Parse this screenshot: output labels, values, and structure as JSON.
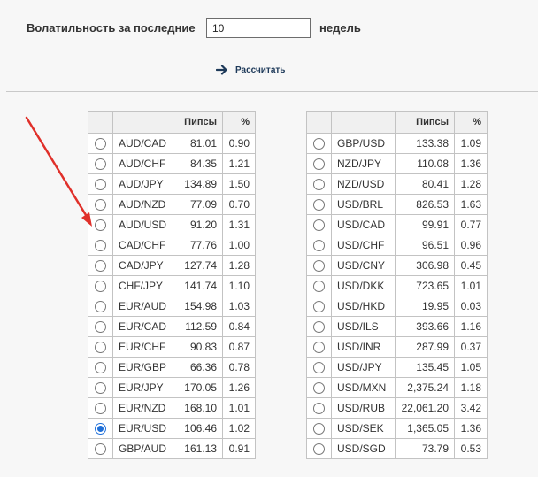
{
  "form": {
    "label": "Волатильность за последние",
    "weeks_value": "10",
    "weeks_unit": "недель",
    "calculate_label": "Рассчитать"
  },
  "table_headers": {
    "pips": "Пипсы",
    "percent": "%"
  },
  "left_rows": [
    {
      "pair": "AUD/CAD",
      "pips": "81.01",
      "pct": "0.90",
      "selected": false
    },
    {
      "pair": "AUD/CHF",
      "pips": "84.35",
      "pct": "1.21",
      "selected": false
    },
    {
      "pair": "AUD/JPY",
      "pips": "134.89",
      "pct": "1.50",
      "selected": false
    },
    {
      "pair": "AUD/NZD",
      "pips": "77.09",
      "pct": "0.70",
      "selected": false
    },
    {
      "pair": "AUD/USD",
      "pips": "91.20",
      "pct": "1.31",
      "selected": false
    },
    {
      "pair": "CAD/CHF",
      "pips": "77.76",
      "pct": "1.00",
      "selected": false
    },
    {
      "pair": "CAD/JPY",
      "pips": "127.74",
      "pct": "1.28",
      "selected": false
    },
    {
      "pair": "CHF/JPY",
      "pips": "141.74",
      "pct": "1.10",
      "selected": false
    },
    {
      "pair": "EUR/AUD",
      "pips": "154.98",
      "pct": "1.03",
      "selected": false
    },
    {
      "pair": "EUR/CAD",
      "pips": "112.59",
      "pct": "0.84",
      "selected": false
    },
    {
      "pair": "EUR/CHF",
      "pips": "90.83",
      "pct": "0.87",
      "selected": false
    },
    {
      "pair": "EUR/GBP",
      "pips": "66.36",
      "pct": "0.78",
      "selected": false
    },
    {
      "pair": "EUR/JPY",
      "pips": "170.05",
      "pct": "1.26",
      "selected": false
    },
    {
      "pair": "EUR/NZD",
      "pips": "168.10",
      "pct": "1.01",
      "selected": false
    },
    {
      "pair": "EUR/USD",
      "pips": "106.46",
      "pct": "1.02",
      "selected": true
    },
    {
      "pair": "GBP/AUD",
      "pips": "161.13",
      "pct": "0.91",
      "selected": false
    }
  ],
  "right_rows": [
    {
      "pair": "GBP/USD",
      "pips": "133.38",
      "pct": "1.09",
      "selected": false
    },
    {
      "pair": "NZD/JPY",
      "pips": "110.08",
      "pct": "1.36",
      "selected": false
    },
    {
      "pair": "NZD/USD",
      "pips": "80.41",
      "pct": "1.28",
      "selected": false
    },
    {
      "pair": "USD/BRL",
      "pips": "826.53",
      "pct": "1.63",
      "selected": false
    },
    {
      "pair": "USD/CAD",
      "pips": "99.91",
      "pct": "0.77",
      "selected": false
    },
    {
      "pair": "USD/CHF",
      "pips": "96.51",
      "pct": "0.96",
      "selected": false
    },
    {
      "pair": "USD/CNY",
      "pips": "306.98",
      "pct": "0.45",
      "selected": false
    },
    {
      "pair": "USD/DKK",
      "pips": "723.65",
      "pct": "1.01",
      "selected": false
    },
    {
      "pair": "USD/HKD",
      "pips": "19.95",
      "pct": "0.03",
      "selected": false
    },
    {
      "pair": "USD/ILS",
      "pips": "393.66",
      "pct": "1.16",
      "selected": false
    },
    {
      "pair": "USD/INR",
      "pips": "287.99",
      "pct": "0.37",
      "selected": false
    },
    {
      "pair": "USD/JPY",
      "pips": "135.45",
      "pct": "1.05",
      "selected": false
    },
    {
      "pair": "USD/MXN",
      "pips": "2,375.24",
      "pct": "1.18",
      "selected": false
    },
    {
      "pair": "USD/RUB",
      "pips": "22,061.20",
      "pct": "3.42",
      "selected": false
    },
    {
      "pair": "USD/SEK",
      "pips": "1,365.05",
      "pct": "1.36",
      "selected": false
    },
    {
      "pair": "USD/SGD",
      "pips": "73.79",
      "pct": "0.53",
      "selected": false
    }
  ],
  "colors": {
    "annotation_arrow": "#e0302a",
    "link": "#1e3a5a",
    "radio_selected": "#1f6fd8"
  },
  "icons": {
    "calculate": "arrow-right-icon"
  }
}
